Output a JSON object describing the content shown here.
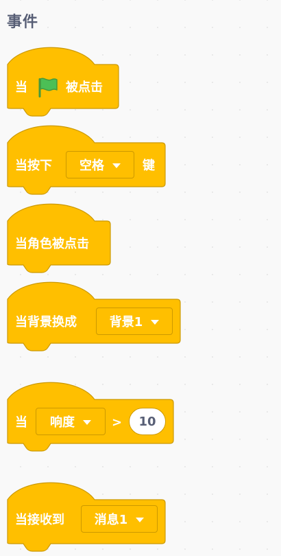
{
  "category": {
    "title": "事件"
  },
  "colors": {
    "block_fill": "#ffbf00",
    "block_stroke": "#cc9900",
    "text": "#ffffff",
    "input_text": "#575e75",
    "flag": "#4cbf56"
  },
  "blocks": {
    "green_flag": {
      "prefix": "当",
      "suffix": "被点击",
      "icon": "green-flag-icon"
    },
    "key_pressed": {
      "prefix": "当按下",
      "key": "空格",
      "suffix": "键"
    },
    "sprite_clicked": {
      "label": "当角色被点击"
    },
    "backdrop_switch": {
      "prefix": "当背景换成",
      "backdrop": "背景1"
    },
    "greater_than": {
      "prefix": "当",
      "sensor": "响度",
      "operator": ">",
      "value": "10"
    },
    "receive_message": {
      "prefix": "当接收到",
      "message": "消息1"
    }
  }
}
